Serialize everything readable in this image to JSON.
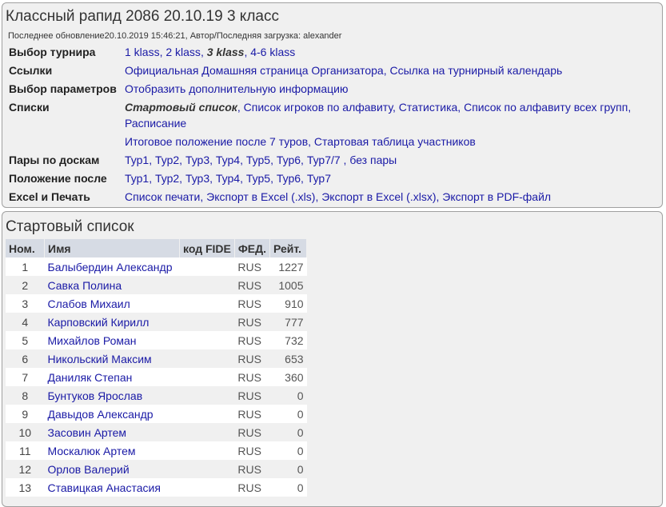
{
  "header": {
    "title": "Классный рапид 2086 20.10.19 3 класс",
    "update_line": "Последнее обновление20.10.2019 15:46:21, Автор/Последняя загрузка: alexander"
  },
  "rows": {
    "tournament": {
      "label": "Выбор турнира",
      "links": [
        "1 klass",
        "2 klass",
        "3 klass",
        "4-6 klass"
      ]
    },
    "links": {
      "label": "Ссылки",
      "links": [
        "Официальная Домашняя страница Организатора",
        "Ссылка на турнирный календарь"
      ]
    },
    "params": {
      "label": "Выбор параметров",
      "links": [
        "Отобразить дополнительную информацию"
      ]
    },
    "lists": {
      "label": "Списки",
      "links_line1": [
        "Стартовый список",
        "Список игроков по алфавиту",
        "Статистика",
        "Список по алфавиту всех групп"
      ],
      "links_line2": [
        "Расписание"
      ],
      "links_line3": [
        "Итоговое положение после 7 туров",
        "Стартовая таблица участников"
      ]
    },
    "pairs": {
      "label": "Пары по доскам",
      "links": [
        "Тур1",
        "Тур2",
        "Тур3",
        "Тур4",
        "Тур5",
        "Тур6",
        "Тур7/7",
        "без пары"
      ]
    },
    "standings": {
      "label": "Положение после",
      "links": [
        "Тур1",
        "Тур2",
        "Тур3",
        "Тур4",
        "Тур5",
        "Тур6",
        "Тур7"
      ]
    },
    "excel": {
      "label": "Excel и Печать",
      "links": [
        "Список печати",
        "Экспорт в Excel (.xls)",
        "Экспорт в Excel (.xlsx)",
        "Экспорт в PDF-файл"
      ]
    }
  },
  "start_list": {
    "title": "Стартовый список",
    "columns": [
      "Ном.",
      "Имя",
      "код FIDE",
      "ФЕД.",
      "Рейт."
    ],
    "players": [
      {
        "no": "1",
        "name": "Балыбердин Александр",
        "fide": "",
        "fed": "RUS",
        "rating": "1227"
      },
      {
        "no": "2",
        "name": "Савка Полина",
        "fide": "",
        "fed": "RUS",
        "rating": "1005"
      },
      {
        "no": "3",
        "name": "Слабов Михаил",
        "fide": "",
        "fed": "RUS",
        "rating": "910"
      },
      {
        "no": "4",
        "name": "Карповский Кирилл",
        "fide": "",
        "fed": "RUS",
        "rating": "777"
      },
      {
        "no": "5",
        "name": "Михайлов Роман",
        "fide": "",
        "fed": "RUS",
        "rating": "732"
      },
      {
        "no": "6",
        "name": "Никольский Максим",
        "fide": "",
        "fed": "RUS",
        "rating": "653"
      },
      {
        "no": "7",
        "name": "Даниляк Степан",
        "fide": "",
        "fed": "RUS",
        "rating": "360"
      },
      {
        "no": "8",
        "name": "Бунтуков Ярослав",
        "fide": "",
        "fed": "RUS",
        "rating": "0"
      },
      {
        "no": "9",
        "name": "Давыдов Александр",
        "fide": "",
        "fed": "RUS",
        "rating": "0"
      },
      {
        "no": "10",
        "name": "Засовин Артем",
        "fide": "",
        "fed": "RUS",
        "rating": "0"
      },
      {
        "no": "11",
        "name": "Москалюк Артем",
        "fide": "",
        "fed": "RUS",
        "rating": "0"
      },
      {
        "no": "12",
        "name": "Орлов Валерий",
        "fide": "",
        "fed": "RUS",
        "rating": "0"
      },
      {
        "no": "13",
        "name": "Ставицкая Анастасия",
        "fide": "",
        "fed": "RUS",
        "rating": "0"
      }
    ]
  }
}
